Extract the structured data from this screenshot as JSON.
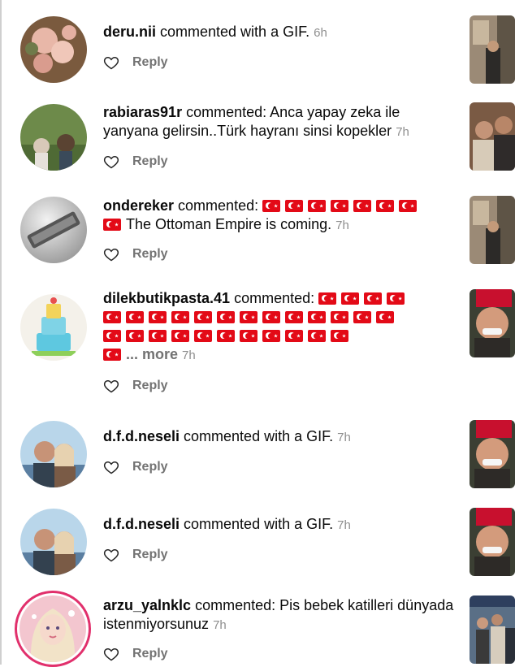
{
  "reply_label": "Reply",
  "icons": {
    "like": "heart-outline-icon"
  },
  "comments": [
    {
      "username": "deru.nii",
      "action": " commented with a GIF.",
      "time": "6h"
    },
    {
      "username": "rabiaras91r",
      "action": " commented: Anca yapay zeka ile yanyana gelirsin..Türk hayranı sinsi kopekler",
      "time": "7h"
    },
    {
      "username": "ondereker",
      "action": " commented:",
      "flags_before": 8,
      "text_after": "The Ottoman Empire is coming.",
      "time": "7h"
    },
    {
      "username": "dilekbutikpasta.41",
      "action": " commented:",
      "flags_before": 26,
      "more": "... more",
      "time": "7h"
    },
    {
      "username": "d.f.d.neseli",
      "action": " commented with a GIF.",
      "time": "7h"
    },
    {
      "username": "d.f.d.neseli",
      "action": " commented with a GIF.",
      "time": "7h"
    },
    {
      "username": "arzu_yalnklc",
      "action": " commented: Pis bebek katilleri dünyada istenmiyorsunuz",
      "time": "7h"
    }
  ]
}
